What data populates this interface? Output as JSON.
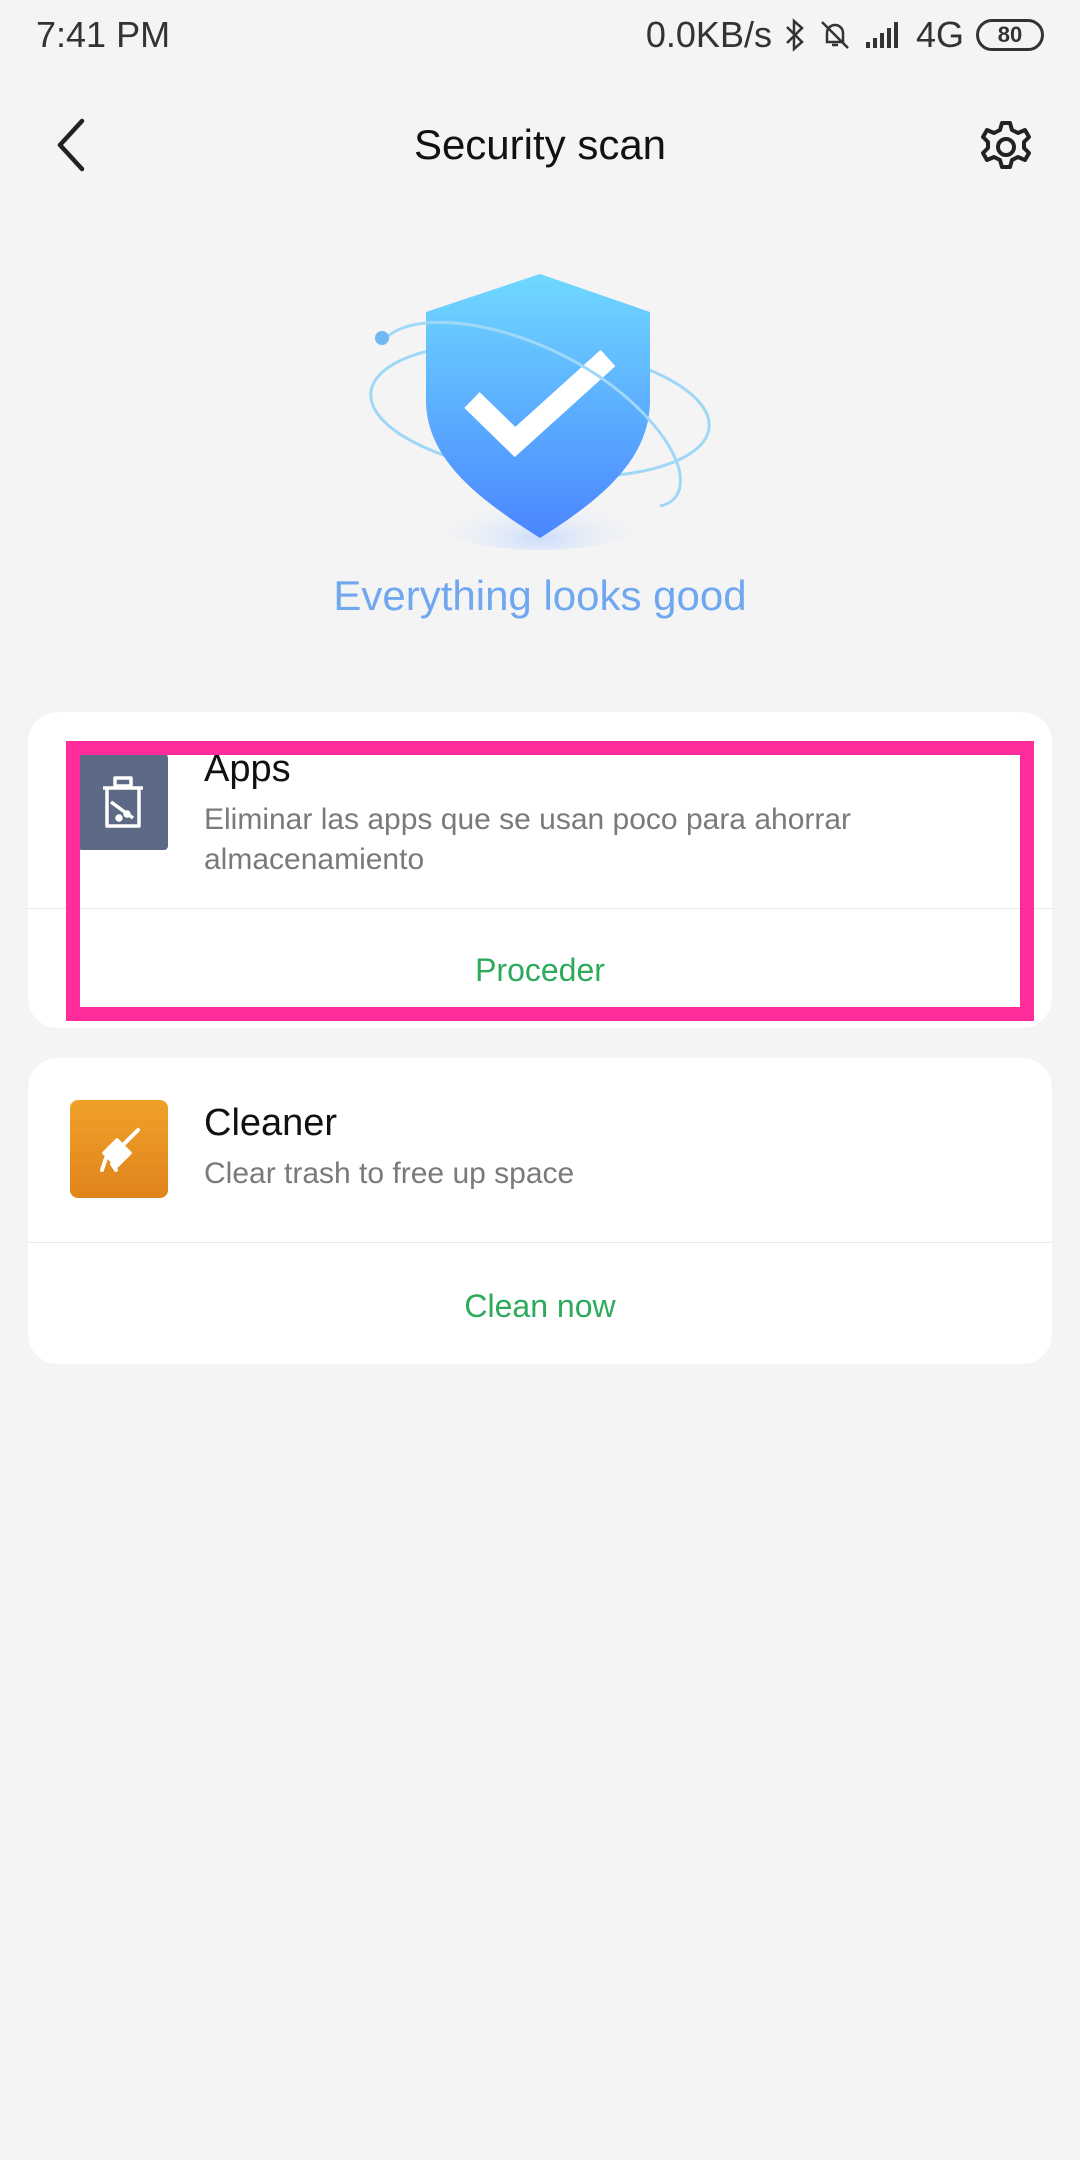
{
  "status_bar": {
    "time": "7:41 PM",
    "network_speed": "0.0KB/s",
    "network_type": "4G",
    "battery": "80"
  },
  "header": {
    "title": "Security scan",
    "back_icon": "chevron-left-icon",
    "settings_icon": "gear-icon"
  },
  "hero": {
    "icon": "shield-check-icon",
    "message": "Everything looks good",
    "colors": {
      "shield_top": "#6fd8ff",
      "shield_bottom": "#4a86ff",
      "message": "#6fa8f0"
    }
  },
  "cards": [
    {
      "icon": "trash-can-icon",
      "title": "Apps",
      "description": "Eliminar las apps que se usan poco para ahorrar almacenamiento",
      "action": "Proceder",
      "icon_color": "#5c6a85"
    },
    {
      "icon": "broom-icon",
      "title": "Cleaner",
      "description": "Clear trash to free up space",
      "action": "Clean now",
      "icon_color": "#f0a12a"
    }
  ],
  "accent_color": "#2daa5c",
  "highlight_color": "#ff2d9b"
}
